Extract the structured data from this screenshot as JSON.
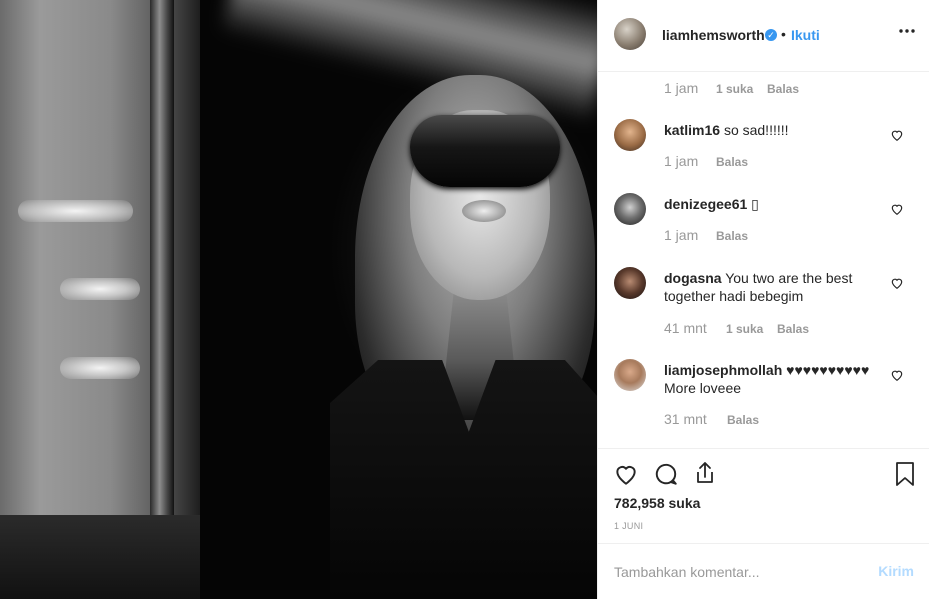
{
  "post": {
    "author": "liamhemsworth",
    "separator": "•",
    "follow_label": "Ikuti",
    "more_label": "•••"
  },
  "first_meta": {
    "time": "1 jam",
    "likes": "1 suka",
    "reply": "Balas"
  },
  "comments": [
    {
      "username": "katlim16",
      "text": "so sad!!!!!!",
      "time": "1 jam",
      "likes": "",
      "reply": "Balas"
    },
    {
      "username": "denizegee61",
      "text": "▯",
      "time": "1 jam",
      "likes": "",
      "reply": "Balas"
    },
    {
      "username": "dogasna",
      "text": "You two are the best together hadi bebegim",
      "time": "41 mnt",
      "likes": "1 suka",
      "reply": "Balas"
    },
    {
      "username": "liamjosephmollah",
      "text": "♥♥♥♥♥♥♥♥♥♥ More loveee",
      "time": "31 mnt",
      "likes": "",
      "reply": "Balas"
    }
  ],
  "stats": {
    "likes": "782,958 suka",
    "date": "1 JUNI"
  },
  "composer": {
    "placeholder": "Tambahkan komentar...",
    "send_label": "Kirim"
  },
  "colors": {
    "accent": "#3897f0",
    "muted": "#999999",
    "send_disabled": "#b3dbff"
  },
  "icons": [
    "heart-icon",
    "comment-icon",
    "share-icon",
    "bookmark-icon",
    "verified-icon",
    "more-options-icon"
  ]
}
